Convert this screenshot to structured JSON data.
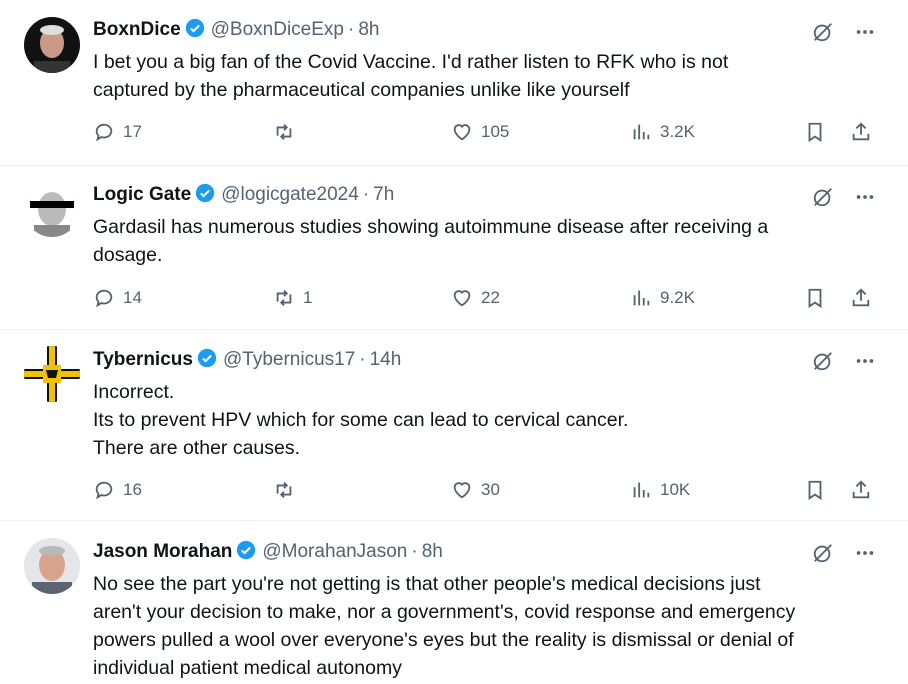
{
  "colors": {
    "accent": "#1d9bf0",
    "muted": "#536471",
    "text": "#0f1419",
    "divider": "#eff3f4"
  },
  "icons": {
    "verified": "verified-badge-icon",
    "grok": "grok-icon",
    "more": "more-icon",
    "reply": "reply-icon",
    "repost": "repost-icon",
    "like": "like-icon",
    "views": "views-icon",
    "bookmark": "bookmark-icon",
    "share": "share-icon"
  },
  "tweets": [
    {
      "name": "BoxnDice",
      "handle": "@BoxnDiceExp",
      "time": "8h",
      "lines": [
        "I bet you a big fan of the Covid Vaccine. I'd rather listen to RFK who is not",
        "captured by the pharmaceutical companies unlike like yourself"
      ],
      "replies": "17",
      "reposts": "",
      "likes": "105",
      "views": "3.2K"
    },
    {
      "name": "Logic Gate",
      "handle": "@logicgate2024",
      "time": "7h",
      "lines": [
        "Gardasil has numerous studies showing autoimmune disease after receiving a",
        "dosage."
      ],
      "replies": "14",
      "reposts": "1",
      "likes": "22",
      "views": "9.2K"
    },
    {
      "name": "Tybernicus",
      "handle": "@Tybernicus17",
      "time": "14h",
      "lines": [
        "Incorrect.",
        "Its to prevent HPV which for some can lead to cervical cancer.",
        "There are other causes."
      ],
      "replies": "16",
      "reposts": "",
      "likes": "30",
      "views": "10K"
    },
    {
      "name": "Jason Morahan",
      "handle": "@MorahanJason",
      "time": "8h",
      "lines": [
        "No see the part you're not getting is that other people's medical decisions just",
        "aren't your decision to make, nor a government's, covid response and emergency",
        "powers pulled a wool over everyone's eyes but the reality is dismissal or denial of",
        "individual patient medical autonomy"
      ]
    }
  ]
}
